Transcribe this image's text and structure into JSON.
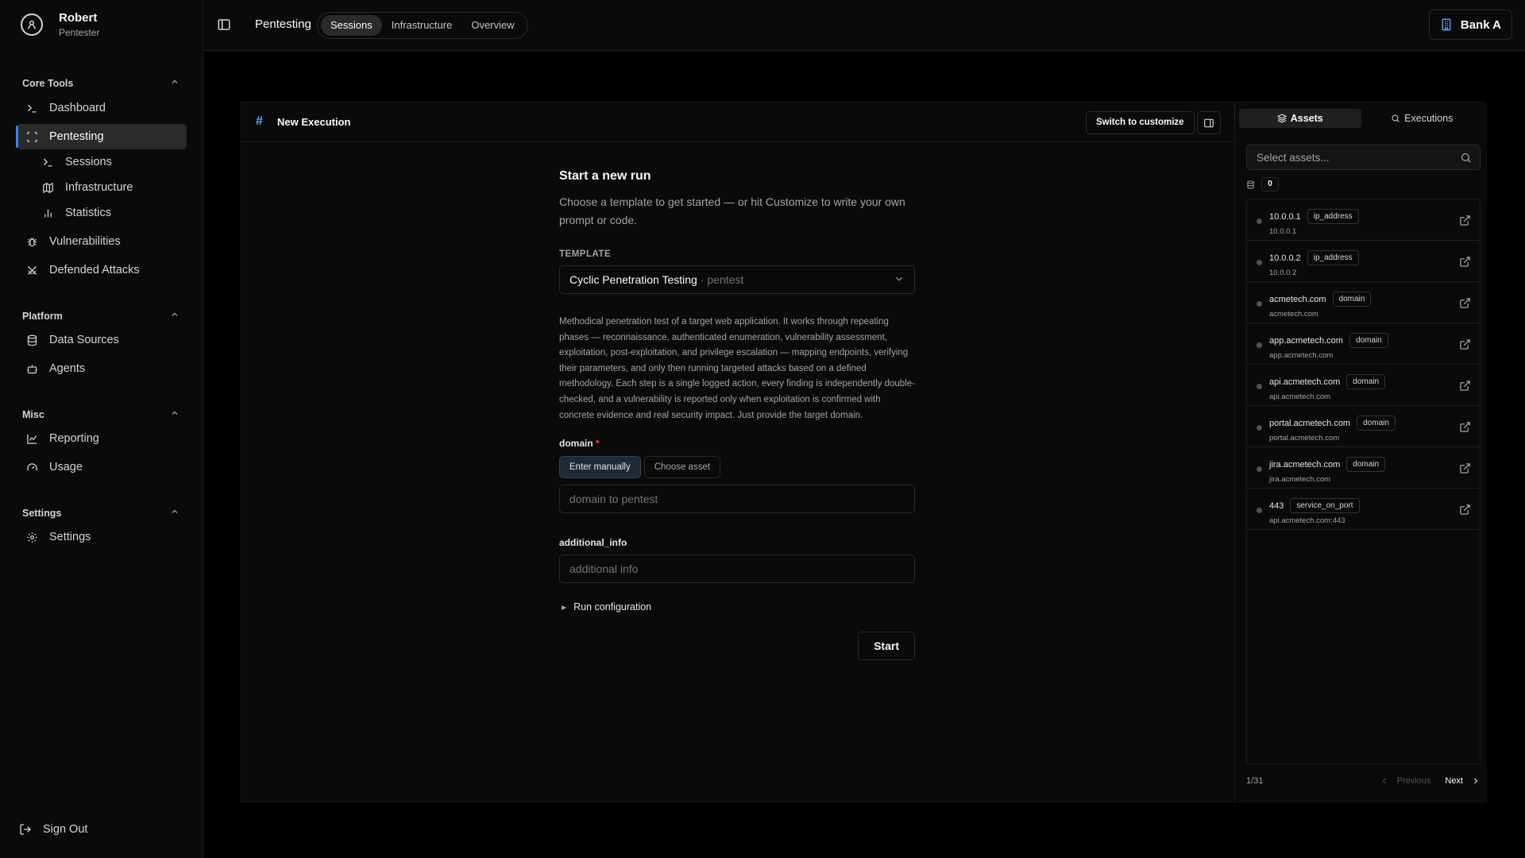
{
  "user": {
    "name": "Robert",
    "role": "Pentester"
  },
  "sidebar": {
    "groups": [
      {
        "title": "Core Tools"
      },
      {
        "title": "Platform"
      },
      {
        "title": "Misc"
      },
      {
        "title": "Settings"
      }
    ],
    "items": {
      "dashboard": "Dashboard",
      "pentesting": "Pentesting",
      "sessions": "Sessions",
      "infrastructure": "Infrastructure",
      "statistics": "Statistics",
      "vulnerabilities": "Vulnerabilities",
      "defended_attacks": "Defended Attacks",
      "data_sources": "Data Sources",
      "agents": "Agents",
      "reporting": "Reporting",
      "usage": "Usage",
      "settings": "Settings"
    },
    "sign_out": "Sign Out"
  },
  "topbar": {
    "section": "Pentesting",
    "tabs": [
      "Sessions",
      "Infrastructure",
      "Overview"
    ],
    "active_tab": "Sessions",
    "org": "Bank A"
  },
  "card": {
    "title": "New Execution",
    "customize_label": "Switch to customize"
  },
  "form": {
    "heading": "Start a new run",
    "lead": "Choose a template to get started — or hit Customize to write your own prompt or code.",
    "template_label": "TEMPLATE",
    "template_name": "Cyclic Penetration Testing",
    "template_tag": "· pentest",
    "description": "Methodical penetration test of a target web application. It works through repeating phases — reconnaissance, authenticated enumeration, vulnerability assessment, exploitation, post-exploitation, and privilege escalation — mapping endpoints, verifying their parameters, and only then running targeted attacks based on a defined methodology. Each step is a single logged action, every finding is independently double-checked, and a vulnerability is reported only when exploitation is confirmed with concrete evidence and real security impact. Just provide the target domain.",
    "domain_label": "domain",
    "required_mark": "*",
    "mode_manual": "Enter manually",
    "mode_asset": "Choose asset",
    "domain_placeholder": "domain to pentest",
    "additional_label": "additional_info",
    "additional_placeholder": "additional info",
    "run_config": "Run configuration",
    "start": "Start"
  },
  "assets_panel": {
    "tabs": [
      "Assets",
      "Executions"
    ],
    "active_tab": "Assets",
    "search_placeholder": "Select assets...",
    "selected_count": "0",
    "items": [
      {
        "name": "10.0.0.1",
        "type": "ip_address",
        "value": "10.0.0.1"
      },
      {
        "name": "10.0.0.2",
        "type": "ip_address",
        "value": "10.0.0.2"
      },
      {
        "name": "acmetech.com",
        "type": "domain",
        "value": "acmetech.com"
      },
      {
        "name": "app.acmetech.com",
        "type": "domain",
        "value": "app.acmetech.com"
      },
      {
        "name": "api.acmetech.com",
        "type": "domain",
        "value": "api.acmetech.com"
      },
      {
        "name": "portal.acmetech.com",
        "type": "domain",
        "value": "portal.acmetech.com"
      },
      {
        "name": "jira.acmetech.com",
        "type": "domain",
        "value": "jira.acmetech.com"
      },
      {
        "name": "443",
        "type": "service_on_port",
        "value": "api.acmetech.com:443"
      }
    ],
    "page": "1/31",
    "prev": "Previous",
    "next": "Next"
  },
  "colors": {
    "accent": "#3b82f6",
    "required": "#ef4444",
    "background": "#000000",
    "surface": "#0a0a0a"
  }
}
